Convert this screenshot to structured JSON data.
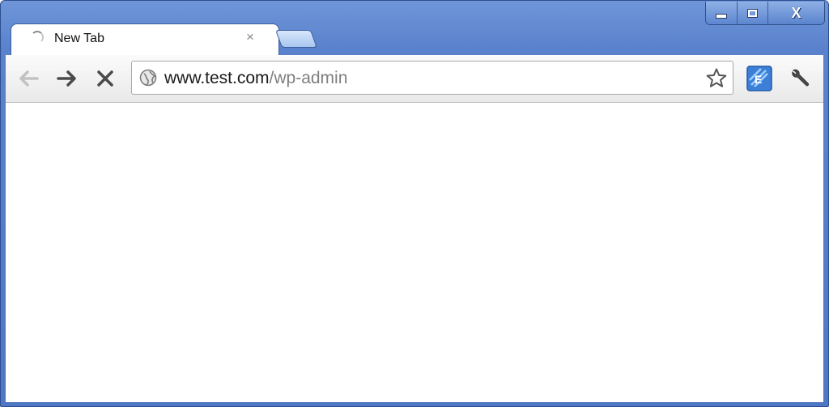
{
  "window": {
    "controls": {
      "minimize_icon": "minimize-icon",
      "maximize_icon": "maximize-icon",
      "close_glyph": "X"
    }
  },
  "tabs": [
    {
      "title": "New Tab",
      "loading": true,
      "close_glyph": "×"
    }
  ],
  "toolbar": {
    "back_icon": "arrow-left-icon",
    "forward_icon": "arrow-right-icon",
    "stop_icon": "stop-x-icon",
    "stop_glyph": "✕",
    "omnibox": {
      "host": "www.test.com",
      "path": "/wp-admin"
    },
    "bookmark_icon": "star-icon",
    "extension_icon": "extension-icon",
    "menu_icon": "wrench-icon"
  },
  "colors": {
    "frame": "#5a82cc",
    "toolbar": "#f2f2f2",
    "url_host": "#1a1a1a",
    "url_path": "#7f7f7f"
  }
}
